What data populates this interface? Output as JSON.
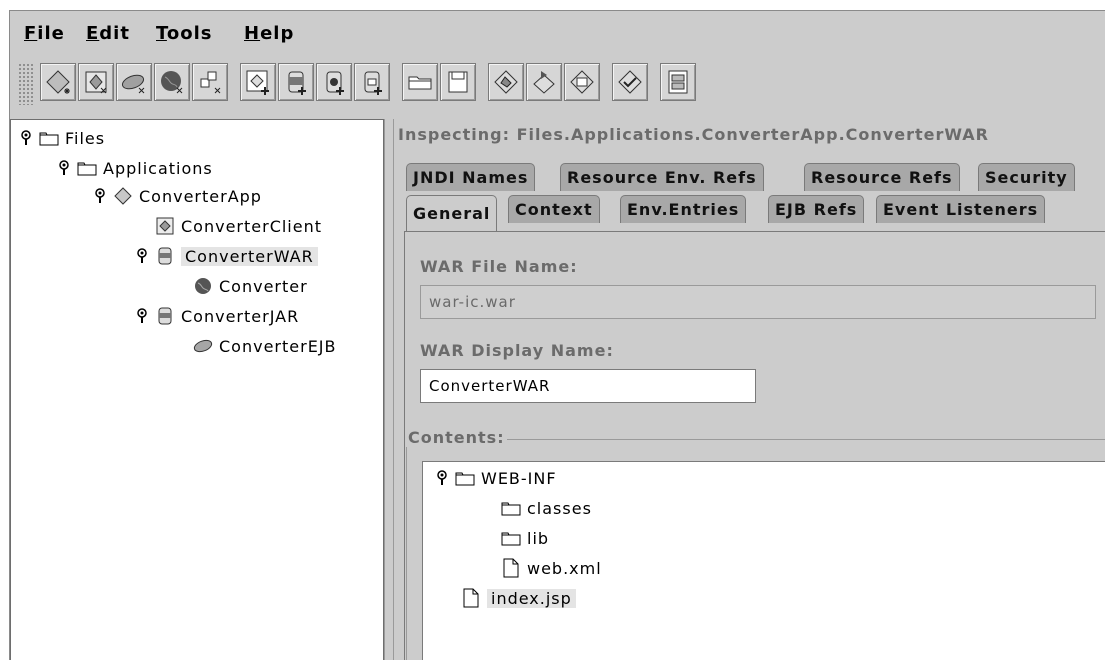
{
  "menu": {
    "items": [
      {
        "mnemonic": "F",
        "rest": "ile"
      },
      {
        "mnemonic": "E",
        "rest": "dit"
      },
      {
        "mnemonic": "T",
        "rest": "ools"
      },
      {
        "mnemonic": "H",
        "rest": "elp"
      }
    ]
  },
  "toolbar": {
    "buttons": [
      "new-application-icon",
      "new-application-client-icon",
      "new-enterprise-bean-icon",
      "new-web-component-icon",
      "new-connector-icon",
      "add-to-application-icon",
      "add-war-icon",
      "add-jar-icon",
      "add-rar-icon",
      "open-icon",
      "save-icon",
      "update-icon",
      "deploy-icon",
      "undeploy-icon",
      "verify-icon",
      "server-config-icon"
    ]
  },
  "files_tree": {
    "root": "Files",
    "applications": "Applications",
    "app": "ConverterApp",
    "client": "ConverterClient",
    "war": "ConverterWAR",
    "web_component": "Converter",
    "jar": "ConverterJAR",
    "ejb": "ConverterEJB"
  },
  "inspector": {
    "title": "Inspecting: Files.Applications.ConverterApp.ConverterWAR",
    "tabs_row1": [
      "JNDI Names",
      "Resource Env. Refs",
      "Resource Refs",
      "Security"
    ],
    "tabs_row2": [
      "General",
      "Context",
      "Env.Entries",
      "EJB Refs",
      "Event Listeners"
    ],
    "active_tab": "General",
    "war_file_label": "WAR File Name:",
    "war_file_value": "war-ic.war",
    "war_display_label": "WAR Display Name:",
    "war_display_value": "ConverterWAR",
    "contents_label": "Contents:",
    "contents": {
      "web_inf": "WEB-INF",
      "classes": "classes",
      "lib": "lib",
      "web_xml": "web.xml",
      "index": "index.jsp"
    }
  },
  "colors": {
    "background": "#cccccc",
    "inactive_tab": "#a8a8a8",
    "label_gray": "#6b6b6b"
  }
}
